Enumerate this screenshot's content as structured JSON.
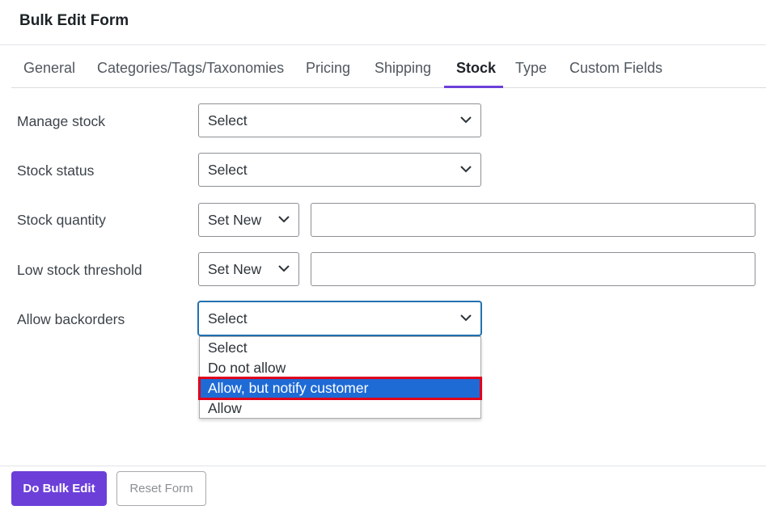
{
  "header": {
    "title": "Bulk Edit Form"
  },
  "tabs": [
    {
      "label": "General"
    },
    {
      "label": "Categories/Tags/Taxonomies"
    },
    {
      "label": "Pricing"
    },
    {
      "label": "Shipping"
    },
    {
      "label": "Stock",
      "active": true
    },
    {
      "label": "Type"
    },
    {
      "label": "Custom Fields"
    }
  ],
  "form": {
    "manage_stock": {
      "label": "Manage stock",
      "value": "Select"
    },
    "stock_status": {
      "label": "Stock status",
      "value": "Select"
    },
    "stock_quantity": {
      "label": "Stock quantity",
      "mode": "Set New",
      "value": ""
    },
    "low_stock_threshold": {
      "label": "Low stock threshold",
      "mode": "Set New",
      "value": ""
    },
    "allow_backorders": {
      "label": "Allow backorders",
      "value": "Select",
      "options": [
        "Select",
        "Do not allow",
        "Allow, but notify customer",
        "Allow"
      ],
      "highlighted_option": "Allow, but notify customer"
    }
  },
  "footer": {
    "submit_label": "Do Bulk Edit",
    "reset_label": "Reset Form"
  },
  "colors": {
    "accent": "#6c3fd9",
    "focus": "#2271b1",
    "highlight": "#1f6bd6",
    "annotation": "#e0001b"
  },
  "icons": {
    "select_arrow": "chevron-down-icon"
  }
}
